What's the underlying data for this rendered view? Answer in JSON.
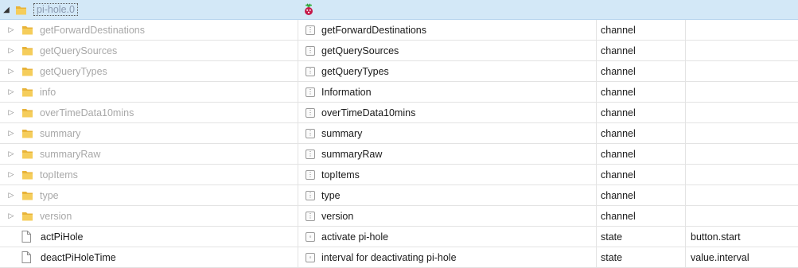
{
  "root": {
    "label": "pi-hole.0",
    "logo_icon": "pi-hole-raspberry-logo",
    "expanded": true
  },
  "rows": [
    {
      "id": "getForwardDestinations",
      "kind": "folder",
      "name": "getForwardDestinations",
      "label": "getForwardDestinations",
      "type": "channel",
      "role": ""
    },
    {
      "id": "getQuerySources",
      "kind": "folder",
      "name": "getQuerySources",
      "label": "getQuerySources",
      "type": "channel",
      "role": ""
    },
    {
      "id": "getQueryTypes",
      "kind": "folder",
      "name": "getQueryTypes",
      "label": "getQueryTypes",
      "type": "channel",
      "role": ""
    },
    {
      "id": "info",
      "kind": "folder",
      "name": "info",
      "label": "Information",
      "type": "channel",
      "role": ""
    },
    {
      "id": "overTimeData10mins",
      "kind": "folder",
      "name": "overTimeData10mins",
      "label": "overTimeData10mins",
      "type": "channel",
      "role": ""
    },
    {
      "id": "summary",
      "kind": "folder",
      "name": "summary",
      "label": "summary",
      "type": "channel",
      "role": ""
    },
    {
      "id": "summaryRaw",
      "kind": "folder",
      "name": "summaryRaw",
      "label": "summaryRaw",
      "type": "channel",
      "role": ""
    },
    {
      "id": "topItems",
      "kind": "folder",
      "name": "topItems",
      "label": "topItems",
      "type": "channel",
      "role": ""
    },
    {
      "id": "type",
      "kind": "folder",
      "name": "type",
      "label": "type",
      "type": "channel",
      "role": ""
    },
    {
      "id": "version",
      "kind": "folder",
      "name": "version",
      "label": "version",
      "type": "channel",
      "role": ""
    },
    {
      "id": "actPiHole",
      "kind": "state",
      "name": "actPiHole",
      "label": "activate pi-hole",
      "type": "state",
      "role": "button.start"
    },
    {
      "id": "deactPiHoleTime",
      "kind": "state",
      "name": "deactPiHoleTime",
      "label": "interval for deactivating pi-hole",
      "type": "state",
      "role": "value.interval"
    }
  ],
  "colors": {
    "header_bg": "#d3e8f7",
    "folder": "#e8b339",
    "muted_text": "#a8a8a8"
  }
}
